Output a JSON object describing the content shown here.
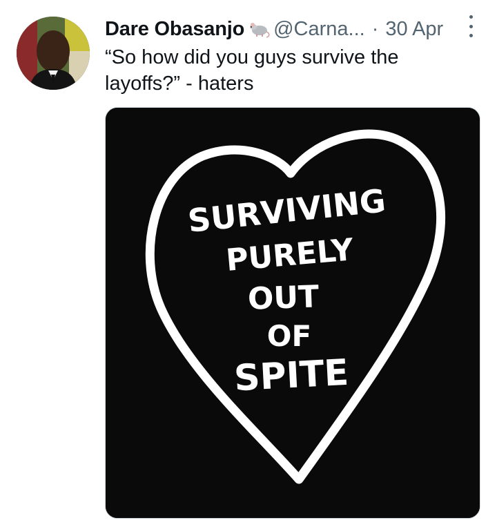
{
  "tweet": {
    "author_name": "Dare Obasanjo",
    "name_emoji_icon": "rat-icon",
    "handle": "@Carna...",
    "separator": "·",
    "date": "30 Apr",
    "text": "“So how did you guys survive the layoffs?” - haters",
    "more_icon": "vertical-ellipsis-icon"
  },
  "media": {
    "heart_text_lines": [
      "SURVIVING",
      "PURELY",
      "OUT",
      "OF",
      "SPITE"
    ],
    "colors": {
      "background": "#0a0a0a",
      "foreground": "#ffffff"
    }
  },
  "colors": {
    "primary_text": "#0f1419",
    "secondary_text": "#536471"
  }
}
